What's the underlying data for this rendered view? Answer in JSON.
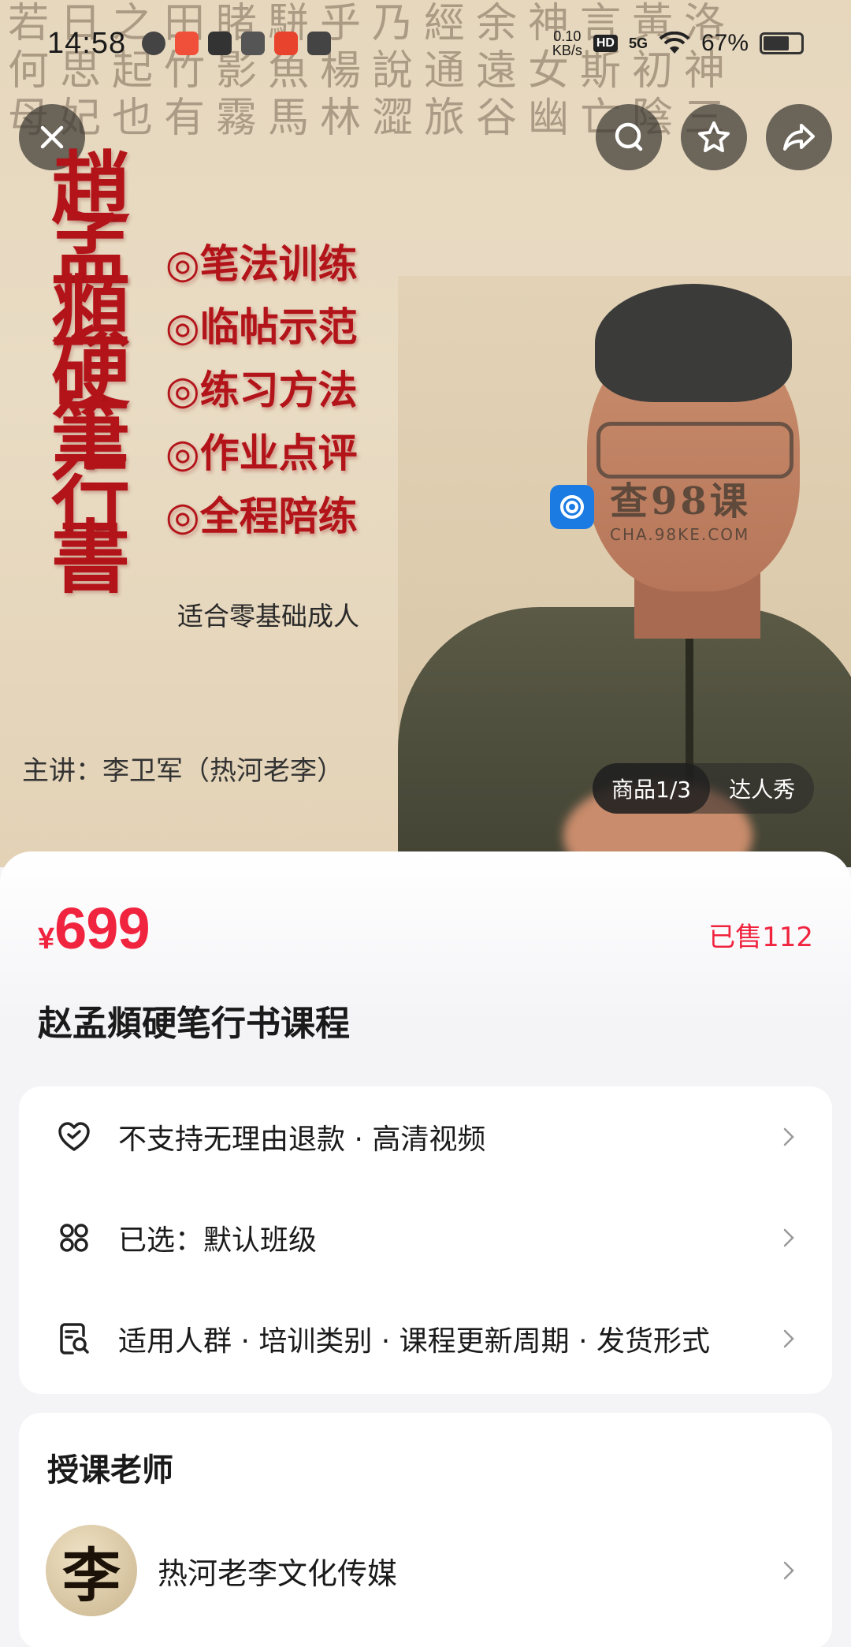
{
  "status_bar": {
    "time": "14:58",
    "net_speed": "0.10",
    "net_unit": "KB/s",
    "hd": "HD",
    "signal": "5G",
    "battery": "67%"
  },
  "hero": {
    "calligraphy_rows": [
      "若日之田睹駢乎乃經余神言黃洛",
      "何思起竹影魚楊說通遠女斯初神",
      "母妃也有霧馬林澀旅谷幽亡陰三"
    ],
    "vertical_title": [
      "趙",
      "孟",
      "頫",
      "硬",
      "筆",
      "行",
      "書"
    ],
    "features": [
      "◎笔法训练",
      "◎临帖示范",
      "◎练习方法",
      "◎作业点评",
      "◎全程陪练"
    ],
    "audience": "适合零基础成人",
    "lecturer": "主讲：李卫军（热河老李）",
    "watermark_title": "查98课",
    "watermark_url": "CHA.98KE.COM",
    "pager_active": "商品1/3",
    "pager_other": "达人秀"
  },
  "product": {
    "currency": "¥",
    "price": "699",
    "sold": "已售112",
    "title": "赵孟頫硬笔行书课程"
  },
  "info_rows": [
    {
      "icon": "heart-shield-icon",
      "text": "不支持无理由退款 · 高清视频"
    },
    {
      "icon": "options-grid-icon",
      "text": "已选：默认班级"
    },
    {
      "icon": "document-search-icon",
      "text": "适用人群 · 培训类别 · 课程更新周期 · 发货形式"
    }
  ],
  "teacher": {
    "heading": "授课老师",
    "avatar_char": "李",
    "name": "热河老李文化传媒"
  },
  "colors": {
    "price_red": "#f0243e",
    "calligraphy_red": "#b3141a"
  }
}
